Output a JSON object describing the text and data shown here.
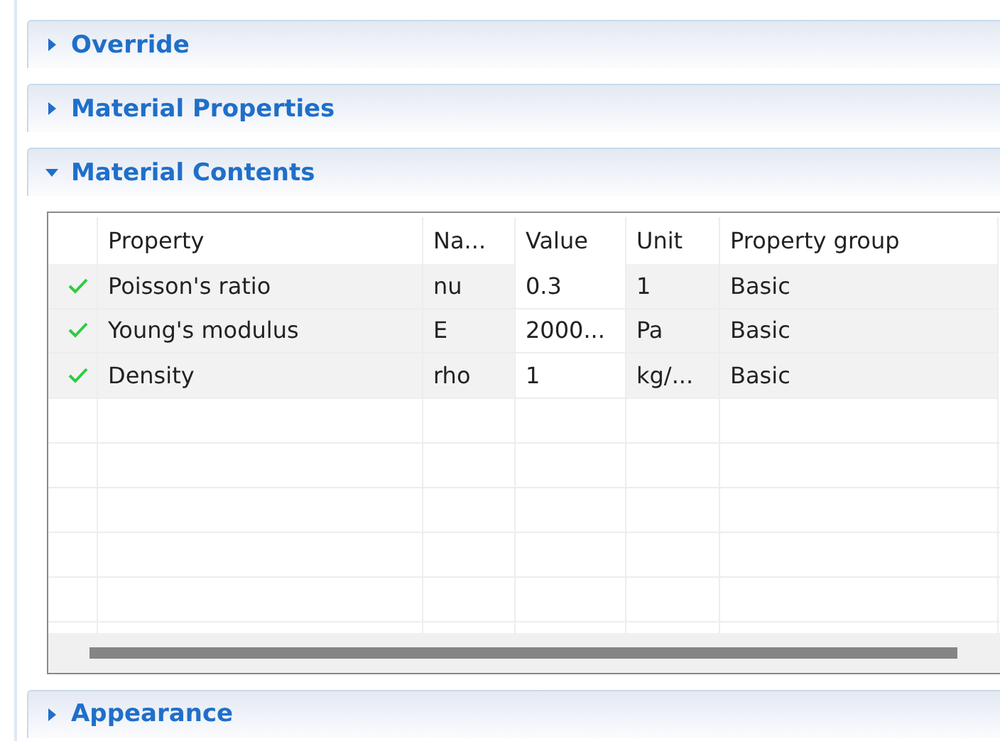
{
  "sections": [
    {
      "title": "Override",
      "expanded": false
    },
    {
      "title": "Material Properties",
      "expanded": false
    },
    {
      "title": "Material Contents",
      "expanded": true,
      "table": {
        "columns": [
          "Property",
          "Na...",
          "Value",
          "Unit",
          "Property group"
        ],
        "rows": [
          {
            "checked": true,
            "cells": [
              "Poisson's ratio",
              "nu",
              "0.3",
              "1",
              "Basic"
            ]
          },
          {
            "checked": true,
            "cells": [
              "Young's modulus",
              "E",
              "2000...",
              "Pa",
              "Basic"
            ]
          },
          {
            "checked": true,
            "cells": [
              "Density",
              "rho",
              "1",
              "kg/...",
              "Basic"
            ]
          }
        ]
      }
    },
    {
      "title": "Appearance",
      "expanded": false
    }
  ]
}
